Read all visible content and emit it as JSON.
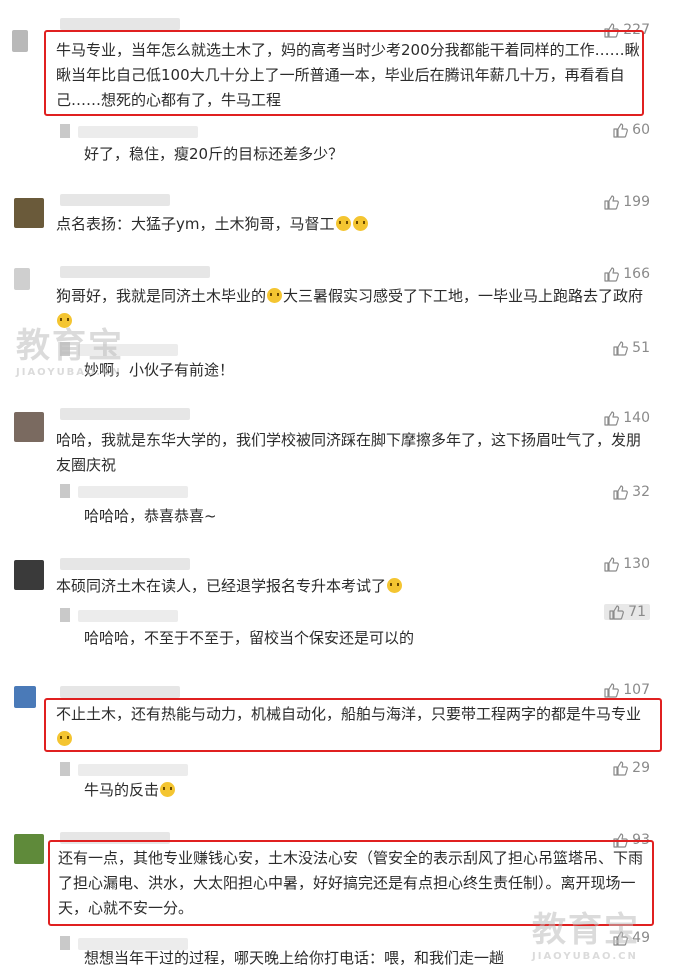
{
  "colors": {
    "highlight_red": "#e02020",
    "text": "#2b2b2b",
    "like_gray": "#8a8a8a"
  },
  "watermark": {
    "brand": "教育宝",
    "domain": "JIAOYUBAO.CN"
  },
  "comments": [
    {
      "text": "牛马专业，当年怎么就选土木了，妈的高考当时少考200分我都能干着同样的工作……瞅瞅当年比自己低100大几十分上了一所普通一本，毕业后在腾讯年薪几十万，再看看自己……想死的心都有了，牛马工程",
      "likes": "227"
    },
    {
      "text": "好了，稳住，瘦20斤的目标还差多少？",
      "likes": "60"
    },
    {
      "text": "点名表扬：大猛子ym，土木狗哥，马督工",
      "likes": "199"
    },
    {
      "text": "狗哥好，我就是同济土木毕业的",
      "text_b": "大三暑假实习感受了下工地，一毕业马上跑路去了政府",
      "likes": "166"
    },
    {
      "text": "妙啊，小伙子有前途！",
      "likes": "51"
    },
    {
      "text": "哈哈，我就是东华大学的，我们学校被同济踩在脚下摩擦多年了，这下扬眉吐气了，发朋友圈庆祝",
      "likes": "140"
    },
    {
      "text": "哈哈哈，恭喜恭喜~",
      "likes": "32"
    },
    {
      "text": "本硕同济土木在读人，已经退学报名专升本考试了",
      "likes": "130"
    },
    {
      "text": "哈哈哈，不至于不至于，留校当个保安还是可以的",
      "likes": "71"
    },
    {
      "text": "不止土木，还有热能与动力，机械自动化，船舶与海洋，只要带工程两字的都是牛马专业",
      "likes": "107"
    },
    {
      "text": "牛马的反击",
      "likes": "29"
    },
    {
      "text": "还有一点，其他专业赚钱心安，土木没法心安（管安全的表示刮风了担心吊篮塔吊、下雨了担心漏电、洪水，大太阳担心中暑，好好搞完还是有点担心终生责任制）。离开现场一天，心就不安一分。",
      "likes": "93"
    },
    {
      "text": "想想当年干过的过程，哪天晚上给你打电话：喂，和我们走一趟",
      "likes": "49"
    }
  ]
}
